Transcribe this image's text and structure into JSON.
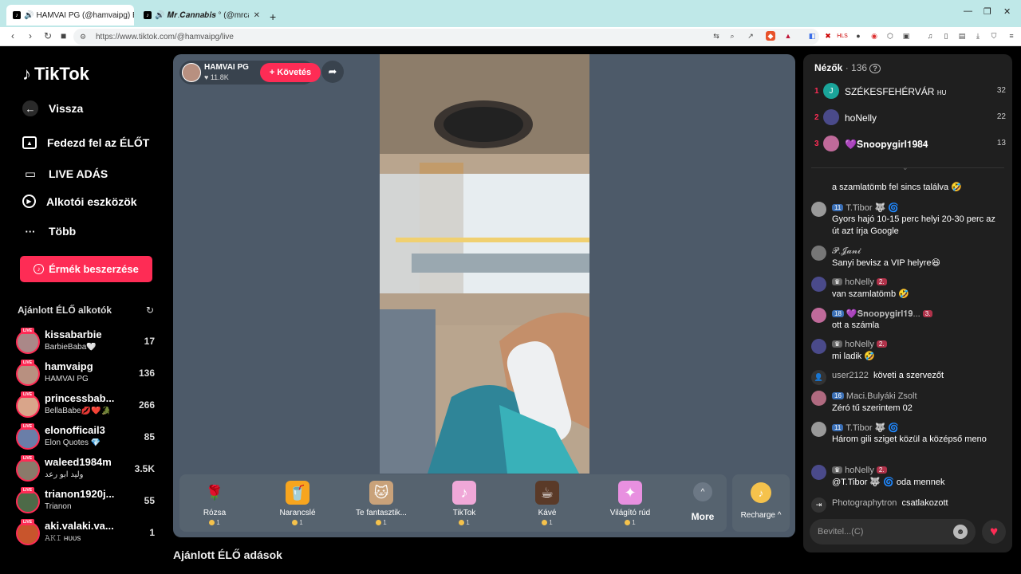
{
  "browser": {
    "tabs": [
      {
        "title": "HAMVAI PG (@hamvaipg) ÉLŐ"
      },
      {
        "title": "𝑴𝒓.𝑪𝒂𝒏𝒏𝒂𝒃𝒊𝒔 ° (@mrcannab"
      }
    ],
    "new_tab": "+",
    "url": "https://www.tiktok.com/@hamvaipg/live"
  },
  "sidebar": {
    "brand": "TikTok",
    "back": "Vissza",
    "nav": [
      "Fedezd fel az ÉLŐT",
      "LIVE ADÁS",
      "Alkotói eszközök",
      "Több"
    ],
    "coins_button": "Érmék beszerzése",
    "recommended_title": "Ajánlott ÉLŐ alkotók",
    "live_badge": "LIVE",
    "creators": [
      {
        "name": "kissabarbie",
        "sub": "BarbieBaba🤍",
        "count": "17"
      },
      {
        "name": "hamvaipg",
        "sub": "HAMVAI PG",
        "count": "136"
      },
      {
        "name": "princessbab...",
        "sub": "BellaBabe💋❤️🐊",
        "count": "266"
      },
      {
        "name": "elonofficail3",
        "sub": "Elon Quotes 💎",
        "count": "85"
      },
      {
        "name": "waleed1984m",
        "sub": "وليد ابو رعد",
        "count": "3.5K"
      },
      {
        "name": "trianon1920j...",
        "sub": "Trianon",
        "count": "55"
      },
      {
        "name": "aki.valaki.va...",
        "sub": "𝙰𝙺𝙸 ʜᴜᴜs",
        "count": "1"
      }
    ]
  },
  "stage": {
    "host_name": "HAMVAI PG",
    "host_likes": "♥ 11.8K",
    "follow": "+ Követés",
    "gifts": [
      {
        "name": "Rózsa",
        "price": "1",
        "icon": "rose-icon"
      },
      {
        "name": "Narancslé",
        "price": "1",
        "icon": "juice-icon"
      },
      {
        "name": "Te fantasztik...",
        "price": "1",
        "icon": "cat-icon"
      },
      {
        "name": "TikTok",
        "price": "1",
        "icon": "tiktok-icon"
      },
      {
        "name": "Kávé",
        "price": "1",
        "icon": "coffee-icon"
      },
      {
        "name": "Világító rúd",
        "price": "1",
        "icon": "lightstick-icon"
      }
    ],
    "more": "More",
    "recharge": "Recharge ^"
  },
  "bottom_heading": "Ajánlott ÉLŐ adások",
  "chat": {
    "viewers_label": "Nézők",
    "viewers_count": "· 136",
    "top_viewers": [
      {
        "rank": "1",
        "name": "SZÉKESFEHÉRVÁR",
        "suffix": "HU",
        "count": "32"
      },
      {
        "rank": "2",
        "name": "hoNelly",
        "suffix": "",
        "count": "22"
      },
      {
        "rank": "3",
        "name": "💜𝐒𝐧𝐨𝐨𝐩𝐲𝐠𝐢𝐫𝐥𝟏𝟗𝟖𝟒",
        "suffix": "",
        "count": "13"
      }
    ],
    "messages": [
      {
        "user": "",
        "badge": "",
        "text": "a szamlatömb fel sincs találva 🤣"
      },
      {
        "user": "T.Tibor 🐺 🌀",
        "badge": "11",
        "text": "Gyors hajó 10-15 perc helyi 20-30 perc az út azt írja Google"
      },
      {
        "user": "𝓟.𝓙𝓪𝓷𝓲",
        "badge": "",
        "text": "Sanyi bevisz a VIP helyre😆"
      },
      {
        "user": "hoNelly",
        "badge": "",
        "pink": "2.",
        "text": "van szamlatömb 🤣"
      },
      {
        "user": "💜𝐒𝐧𝐨𝐨𝐩𝐲𝐠𝐢𝐫𝐥𝟏𝟗...",
        "badge": "18",
        "pink": "3.",
        "text": "ott a számla"
      },
      {
        "user": "hoNelly",
        "badge": "",
        "pink": "2.",
        "text": "mi ladik 🤣"
      },
      {
        "user": "user2122",
        "action": "követi a szervezőt"
      },
      {
        "user": "Maci.Bulyáki Zsolt",
        "badge": "16",
        "text": "Zéró tű szerintem 02"
      },
      {
        "user": "T.Tibor 🐺 🌀",
        "badge": "11",
        "text": "Három gili sziget közül a középső meno"
      },
      {
        "user": "hoNelly",
        "badge": "",
        "pink": "2.",
        "text": "@T.Tibor 🐺 🌀 oda mennek"
      },
      {
        "user": "Photographytron",
        "action": "csatlakozott"
      }
    ],
    "input_placeholder": "Bevitel...(C)"
  }
}
